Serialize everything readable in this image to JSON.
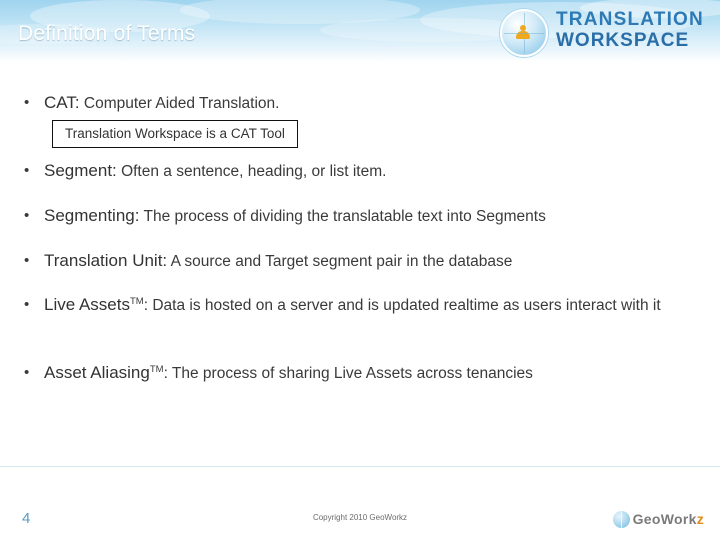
{
  "header": {
    "title": "Definition of Terms",
    "logo": {
      "line1": "TRANSLATION",
      "line2": "WORKSPACE",
      "globe_icon": "globe-person-icon"
    }
  },
  "callout": {
    "text": "Translation Workspace is a CAT Tool"
  },
  "bullets": [
    {
      "marker": "•",
      "term": "CAT:",
      "definition": " Computer Aided Translation.",
      "tm": false
    },
    {
      "marker": "•",
      "term": "Segment:",
      "definition": " Often a sentence, heading, or list item.",
      "tm": false
    },
    {
      "marker": "•",
      "term": "Segmenting:",
      "definition": " The process of dividing the translatable text into Segments",
      "tm": false
    },
    {
      "marker": "•",
      "term": "Translation Unit:",
      "definition": " A source and Target segment pair in the database",
      "tm": false
    },
    {
      "marker": "•",
      "term": "Live Assets",
      "tm_mark": "TM",
      "definition": ": Data is hosted on a server and is updated realtime as users interact with it",
      "tm": true
    },
    {
      "marker": "•",
      "term": "Asset Aliasing",
      "tm_mark": "TM",
      "definition": ": The process of sharing Live Assets across tenancies",
      "tm": true
    }
  ],
  "footer": {
    "slide_number": "4",
    "copyright": "Copyright 2010 GeoWorkz",
    "brand": {
      "name_part1": "Geo",
      "name_part2": "Work",
      "name_part3": "z",
      "globe_icon": "globe-icon"
    }
  }
}
